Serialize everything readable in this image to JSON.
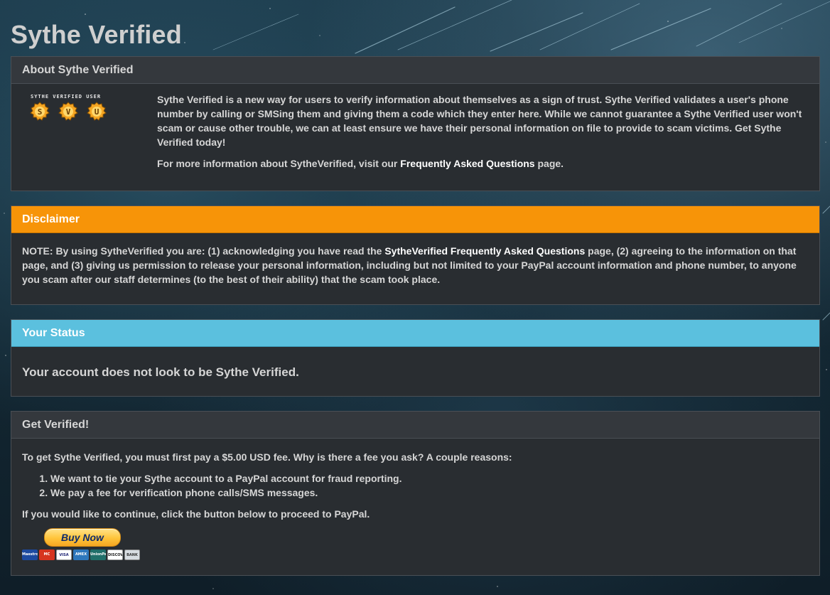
{
  "page": {
    "title": "Sythe Verified"
  },
  "about": {
    "header": "About Sythe Verified",
    "badge_caption": "SYTHE VERIFIED USER",
    "badge_letters": [
      "S",
      "V",
      "U"
    ],
    "paragraph": "Sythe Verified is a new way for users to verify information about themselves as a sign of trust. Sythe Verified validates a user's phone number by calling or SMSing them and giving them a code which they enter here. While we cannot guarantee a Sythe Verified user won't scam or cause other trouble, we can at least ensure we have their personal information on file to provide to scam victims. Get Sythe Verified today!",
    "more_info_prefix": "For more information about SytheVerified, visit our ",
    "more_info_link": "Frequently Asked Questions",
    "more_info_suffix": " page."
  },
  "disclaimer": {
    "header": "Disclaimer",
    "text_prefix": "NOTE: By using SytheVerified you are: (1) acknowledging you have read the ",
    "link": "SytheVerified Frequently Asked Questions",
    "text_suffix": " page, (2) agreeing to the information on that page, and (3) giving us permission to release your personal information, including but not limited to your PayPal account information and phone number, to anyone you scam after our staff determines (to the best of their ability) that the scam took place.",
    "header_color": "#f79408"
  },
  "status": {
    "header": "Your Status",
    "message": "Your account does not look to be Sythe Verified.",
    "header_color": "#5bc0de"
  },
  "get_verified": {
    "header": "Get Verified!",
    "intro": "To get Sythe Verified, you must first pay a $5.00 USD fee. Why is there a fee you ask? A couple reasons:",
    "reasons": [
      "We want to tie your Sythe account to a PayPal account for fraud reporting.",
      "We pay a fee for verification phone calls/SMS messages."
    ],
    "continue_text": "If you would like to continue, click the button below to proceed to PayPal.",
    "buy_button": "Buy Now",
    "cards": [
      {
        "name": "maestro-card-icon",
        "label": "Maestro"
      },
      {
        "name": "mastercard-icon",
        "label": "MC"
      },
      {
        "name": "visa-card-icon",
        "label": "VISA"
      },
      {
        "name": "amex-card-icon",
        "label": "AMEX"
      },
      {
        "name": "unionpay-card-icon",
        "label": "UnionPay"
      },
      {
        "name": "discover-card-icon",
        "label": "DISCOVER"
      },
      {
        "name": "bank-icon",
        "label": "BANK"
      }
    ]
  }
}
